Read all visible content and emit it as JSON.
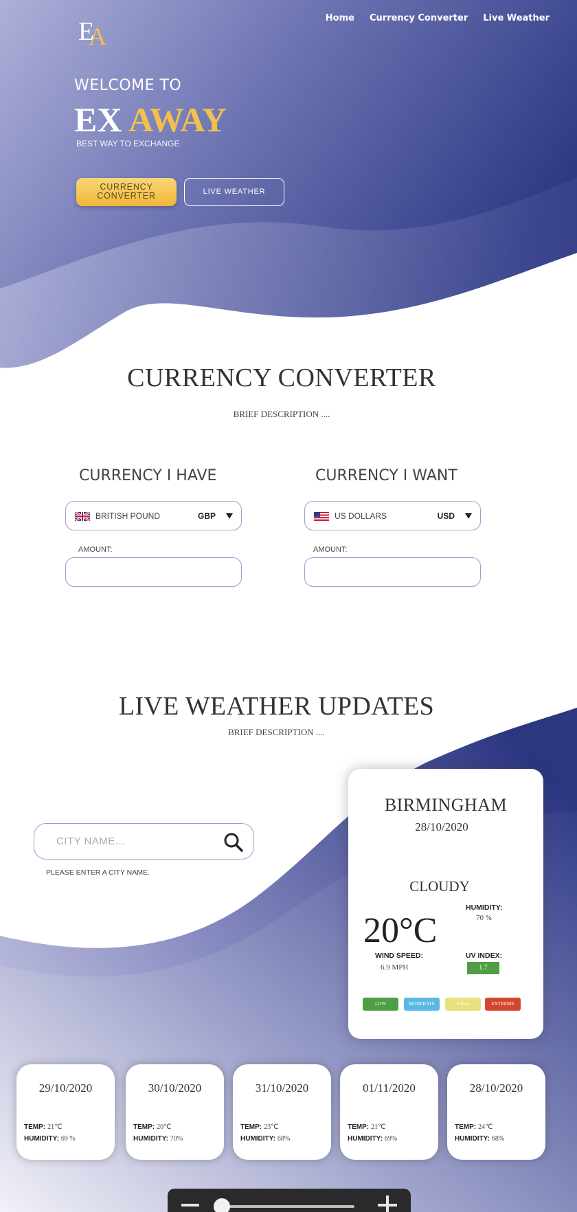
{
  "colors": {
    "accent": "#f3c14b",
    "primary": "#3f4a8f",
    "uv_green": "#4f9d44",
    "low": "#4f9d44",
    "moderate": "#5ab8e6",
    "high": "#e6e27f",
    "extreme": "#d4472c"
  },
  "logo": {
    "letter1": "E",
    "letter2": "A"
  },
  "nav": {
    "home": "Home",
    "currency": "Currency Converter",
    "weather": "Live Weather"
  },
  "hero": {
    "welcome": "WELCOME TO",
    "brand_white": "EX",
    "brand_yellow": "AWAY",
    "tagline": "BEST WAY TO EXCHANGE",
    "btn_currency_line1": "CURRENCY",
    "btn_currency_line2": "CONVERTER",
    "btn_weather": "LIVE WEATHER"
  },
  "currency": {
    "title": "CURRENCY CONVERTER",
    "description": "BRIEF DESCRIPTION ....",
    "have": {
      "title": "CURRENCY I HAVE",
      "flag": "uk-flag-icon",
      "name": "BRITISH POUND",
      "code": "GBP",
      "amount_label": "AMOUNT:",
      "amount_value": ""
    },
    "want": {
      "title": "CURRENCY I WANT",
      "flag": "us-flag-icon",
      "name": "US DOLLARS",
      "code": "USD",
      "amount_label": "AMOUNT:",
      "amount_value": ""
    }
  },
  "weather": {
    "title": "LIVE WEATHER UPDATES",
    "description": "BRIEF DESCRIPTION ....",
    "search_placeholder": "CITY NAME...",
    "search_hint": "PLEASE ENTER A CITY NAME.",
    "card": {
      "city": "BIRMINGHAM",
      "date": "28/10/2020",
      "condition": "CLOUDY",
      "temperature": "20°C",
      "humidity_label": "HUMIDITY:",
      "humidity": "70 %",
      "wind_label": "WIND SPEED:",
      "wind": "6.9 MPH",
      "uv_label": "UV INDEX:",
      "uv": "1.7",
      "scale": [
        "LOW",
        "MODERATE",
        "HIGH",
        "EXTREME"
      ]
    },
    "forecast": [
      {
        "date": "29/10/2020",
        "temp_label": "TEMP:",
        "temp": "21℃",
        "humidity_label": "HUMIDITY:",
        "humidity": "69 %"
      },
      {
        "date": "30/10/2020",
        "temp_label": "TEMP:",
        "temp": "20℃",
        "humidity_label": "HUMIDITY:",
        "humidity": "70%"
      },
      {
        "date": "31/10/2020",
        "temp_label": "TEMP:",
        "temp": "23℃",
        "humidity_label": "HUMIDITY:",
        "humidity": "68%"
      },
      {
        "date": "01/11/2020",
        "temp_label": "TEMP:",
        "temp": "21℃",
        "humidity_label": "HUMIDITY:",
        "humidity": "69%"
      },
      {
        "date": "28/10/2020",
        "temp_label": "TEMP:",
        "temp": "24℃",
        "humidity_label": "HUMIDITY:",
        "humidity": "68%"
      }
    ]
  },
  "zoom": {
    "level_percent": 10
  }
}
